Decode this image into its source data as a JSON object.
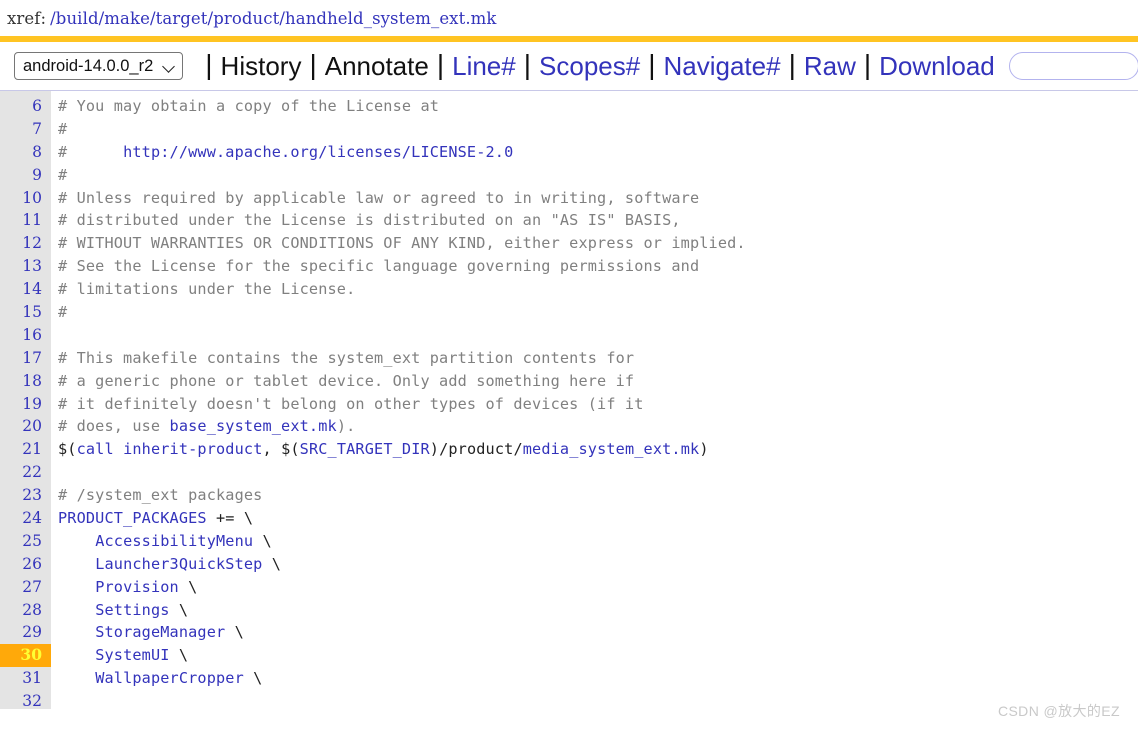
{
  "header": {
    "xref_label": "xref:",
    "path_segments": [
      "build",
      "make",
      "target",
      "product",
      "handheld_system_ext.mk"
    ]
  },
  "toolbar": {
    "branch_selected": "android-14.0.0_r2",
    "chevron_icon": "chevron-down-icon",
    "separator": "|",
    "items": [
      {
        "label": "History",
        "kind": "plain"
      },
      {
        "label": "Annotate",
        "kind": "plain"
      },
      {
        "label": "Line#",
        "kind": "link"
      },
      {
        "label": "Scopes#",
        "kind": "link"
      },
      {
        "label": "Navigate#",
        "kind": "link"
      },
      {
        "label": "Raw",
        "kind": "link"
      },
      {
        "label": "Download",
        "kind": "link"
      }
    ],
    "search_value": "",
    "search_placeholder": ""
  },
  "code": {
    "highlighted_line": 30,
    "first_line": 6,
    "last_line": 32,
    "lines": [
      {
        "n": "6",
        "tokens": [
          {
            "t": "# You may obtain a copy of the License at",
            "c": "cm"
          }
        ]
      },
      {
        "n": "7",
        "tokens": [
          {
            "t": "#",
            "c": "cm"
          }
        ]
      },
      {
        "n": "8",
        "tokens": [
          {
            "t": "#      ",
            "c": "cm"
          },
          {
            "t": "http://www.apache.org/licenses/LICENSE-2.0",
            "c": "lnk"
          }
        ]
      },
      {
        "n": "9",
        "tokens": [
          {
            "t": "#",
            "c": "cm"
          }
        ]
      },
      {
        "n": "10",
        "tokens": [
          {
            "t": "# Unless required by applicable law or agreed to in writing, software",
            "c": "cm"
          }
        ]
      },
      {
        "n": "11",
        "tokens": [
          {
            "t": "# distributed under the License is distributed on an \"AS IS\" BASIS,",
            "c": "cm"
          }
        ]
      },
      {
        "n": "12",
        "tokens": [
          {
            "t": "# WITHOUT WARRANTIES OR CONDITIONS OF ANY KIND, either express or implied.",
            "c": "cm"
          }
        ]
      },
      {
        "n": "13",
        "tokens": [
          {
            "t": "# See the License for the specific language governing permissions and",
            "c": "cm"
          }
        ]
      },
      {
        "n": "14",
        "tokens": [
          {
            "t": "# limitations under the License.",
            "c": "cm"
          }
        ]
      },
      {
        "n": "15",
        "tokens": [
          {
            "t": "#",
            "c": "cm"
          }
        ]
      },
      {
        "n": "16",
        "tokens": [
          {
            "t": "",
            "c": "pln"
          }
        ]
      },
      {
        "n": "17",
        "tokens": [
          {
            "t": "# This makefile contains the system_ext partition contents for",
            "c": "cm"
          }
        ]
      },
      {
        "n": "18",
        "tokens": [
          {
            "t": "# a generic phone or tablet device. Only add something here if",
            "c": "cm"
          }
        ]
      },
      {
        "n": "19",
        "tokens": [
          {
            "t": "# it definitely doesn't belong on other types of devices (if it",
            "c": "cm"
          }
        ]
      },
      {
        "n": "20",
        "tokens": [
          {
            "t": "# does, use ",
            "c": "cm"
          },
          {
            "t": "base_system_ext.mk",
            "c": "lnk"
          },
          {
            "t": ").",
            "c": "cm"
          }
        ]
      },
      {
        "n": "21",
        "tokens": [
          {
            "t": "$(",
            "c": "pln"
          },
          {
            "t": "call",
            "c": "lnk"
          },
          {
            "t": " ",
            "c": "pln"
          },
          {
            "t": "inherit-product",
            "c": "lnk"
          },
          {
            "t": ", $(",
            "c": "pln"
          },
          {
            "t": "SRC_TARGET_DIR",
            "c": "lnk"
          },
          {
            "t": ")/product/",
            "c": "pln"
          },
          {
            "t": "media_system_ext.mk",
            "c": "lnk"
          },
          {
            "t": ")",
            "c": "pln"
          }
        ]
      },
      {
        "n": "22",
        "tokens": [
          {
            "t": "",
            "c": "pln"
          }
        ]
      },
      {
        "n": "23",
        "tokens": [
          {
            "t": "# /system_ext packages",
            "c": "cm"
          }
        ]
      },
      {
        "n": "24",
        "tokens": [
          {
            "t": "PRODUCT_PACKAGES",
            "c": "lnk"
          },
          {
            "t": " += \\",
            "c": "pln"
          }
        ]
      },
      {
        "n": "25",
        "tokens": [
          {
            "t": "    ",
            "c": "pln"
          },
          {
            "t": "AccessibilityMenu",
            "c": "lnk"
          },
          {
            "t": " \\",
            "c": "pln"
          }
        ]
      },
      {
        "n": "26",
        "tokens": [
          {
            "t": "    ",
            "c": "pln"
          },
          {
            "t": "Launcher3QuickStep",
            "c": "lnk"
          },
          {
            "t": " \\",
            "c": "pln"
          }
        ]
      },
      {
        "n": "27",
        "tokens": [
          {
            "t": "    ",
            "c": "pln"
          },
          {
            "t": "Provision",
            "c": "lnk"
          },
          {
            "t": " \\",
            "c": "pln"
          }
        ]
      },
      {
        "n": "28",
        "tokens": [
          {
            "t": "    ",
            "c": "pln"
          },
          {
            "t": "Settings",
            "c": "lnk"
          },
          {
            "t": " \\",
            "c": "pln"
          }
        ]
      },
      {
        "n": "29",
        "tokens": [
          {
            "t": "    ",
            "c": "pln"
          },
          {
            "t": "StorageManager",
            "c": "lnk"
          },
          {
            "t": " \\",
            "c": "pln"
          }
        ]
      },
      {
        "n": "30",
        "tokens": [
          {
            "t": "    ",
            "c": "pln"
          },
          {
            "t": "SystemUI",
            "c": "lnk"
          },
          {
            "t": " \\",
            "c": "pln"
          }
        ]
      },
      {
        "n": "31",
        "tokens": [
          {
            "t": "    ",
            "c": "pln"
          },
          {
            "t": "WallpaperCropper",
            "c": "lnk"
          },
          {
            "t": " \\",
            "c": "pln"
          }
        ]
      },
      {
        "n": "32",
        "tokens": [
          {
            "t": "",
            "c": "pln"
          }
        ]
      }
    ]
  },
  "watermark": {
    "text": "CSDN @放大的EZ"
  },
  "colors": {
    "accent_rule": "#ffc423",
    "link": "#3333bb",
    "comment": "#808080",
    "gutter_bg": "#e4e4e4",
    "highlight_bg": "#ffa90a",
    "highlight_fg": "#ffff33"
  }
}
